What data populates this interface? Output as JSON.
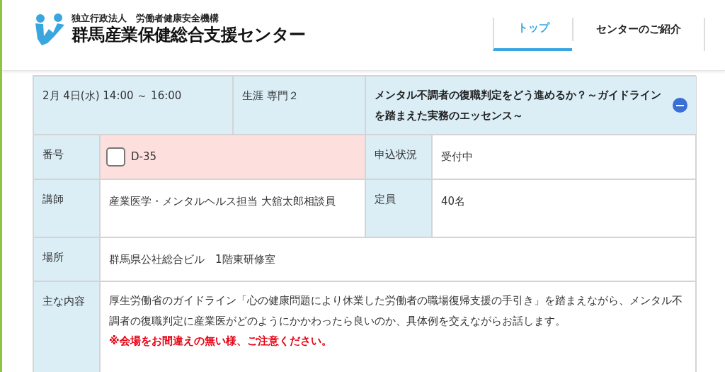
{
  "header": {
    "org": "独立行政法人　労働者健康安全機構",
    "site_name": "群馬産業保健総合支援センター"
  },
  "nav": [
    {
      "label": "トップ",
      "selected": true
    },
    {
      "label": "センターのご紹介",
      "selected": false
    }
  ],
  "seminar": {
    "datetime": "2月 4日(水) 14:00 ～ 16:00",
    "category": "生涯 専門２",
    "title": "メンタル不調者の復職判定をどう進めるか？～ガイドラインを踏まえた実務のエッセンス～",
    "expanded": true,
    "number_label": "番号",
    "number": "D-35",
    "checked": false,
    "status_label": "申込状況",
    "status": "受付中",
    "lecturer_label": "講師",
    "lecturer": "産業医学・メンタルヘルス担当 大舘太郎相談員",
    "capacity_label": "定員",
    "capacity": "40名",
    "venue_label": "場所",
    "venue": "群馬県公社総合ビル　1階東研修室",
    "content_label": "主な内容",
    "content": "厚生労働省のガイドライン「心の健康問題により休業した労働者の職場復帰支援の手引き」を踏まえながら、メンタル不調者の復職判定に産業医がどのようにかかわったら良いのか、具体例を交えながらお話します。",
    "notice": "※会場をお間違えの無い様、ご注意ください。"
  }
}
